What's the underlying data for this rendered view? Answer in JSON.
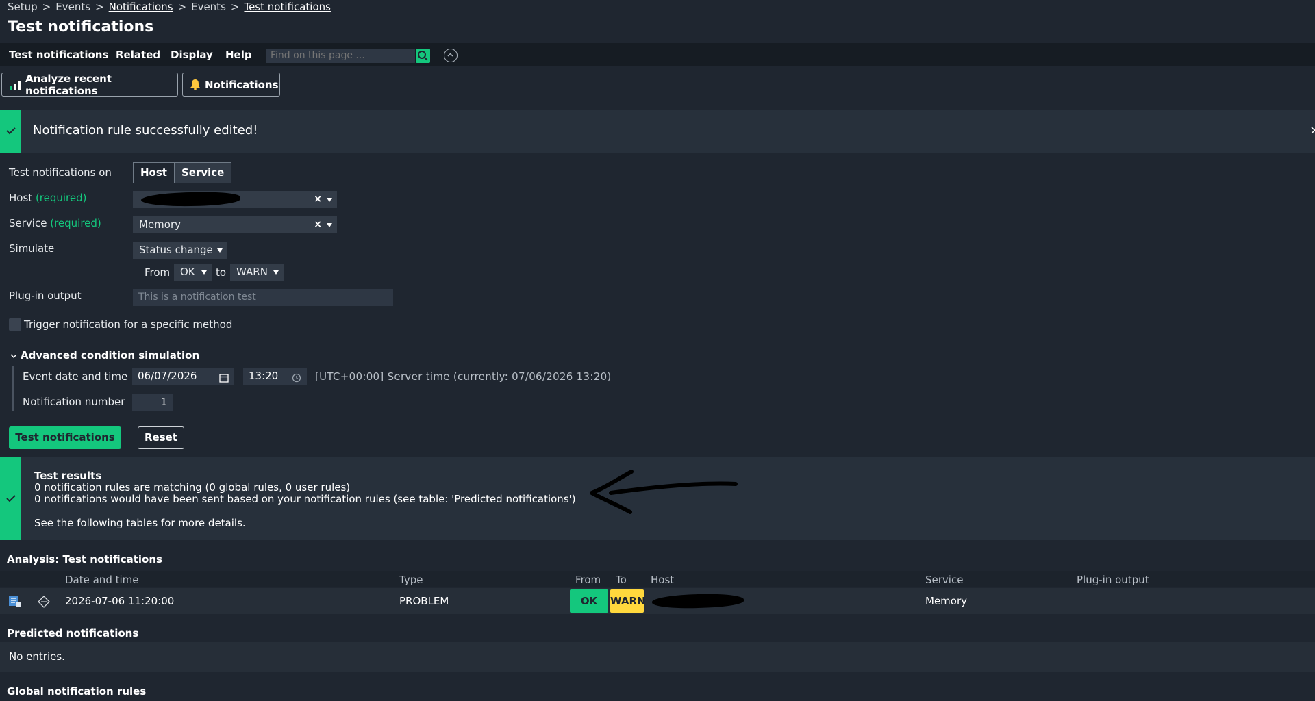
{
  "breadcrumb": {
    "items": [
      "Setup",
      "Events",
      "Notifications",
      "Events",
      "Test notifications"
    ],
    "separator": ">"
  },
  "page_title": "Test notifications",
  "menubar": {
    "items": [
      "Test notifications",
      "Related",
      "Display",
      "Help"
    ],
    "search_placeholder": "Find on this page ..."
  },
  "actions": {
    "analyze_label": "Analyze recent notifications",
    "notifications_label": "Notifications"
  },
  "success_banner": {
    "message": "Notification rule successfully edited!",
    "close": "×"
  },
  "form": {
    "test_on_label": "Test notifications on",
    "test_on_options": [
      "Host",
      "Service"
    ],
    "test_on_selected": "Host",
    "host_label": "Host",
    "required": "(required)",
    "service_label": "Service",
    "service_value": "Memory",
    "clear": "×",
    "simulate_label": "Simulate",
    "simulate_value": "Status change",
    "from_label": "From",
    "from_value": "OK",
    "to_label": "to",
    "to_value": "WARN",
    "plugin_output_label": "Plug-in output",
    "plugin_output_placeholder": "This is a notification test",
    "trigger_label": "Trigger notification for a specific method"
  },
  "advanced": {
    "header": "Advanced condition simulation",
    "date_label": "Event date and time",
    "date_value": "06/07/2026",
    "time_value": "13:20",
    "server_time": "[UTC+00:00] Server time (currently: 07/06/2026 13:20)",
    "number_label": "Notification number",
    "number_value": "1"
  },
  "buttons": {
    "test": "Test notifications",
    "reset": "Reset"
  },
  "results": {
    "title": "Test results",
    "line1": "0 notification rules are matching (0 global rules, 0 user rules)",
    "line2": "0 notifications would have been sent based on your notification rules (see table: 'Predicted notifications')",
    "line3": "See the following tables for more details."
  },
  "analysis": {
    "title": "Analysis: Test notifications",
    "columns": [
      "Date and time",
      "Type",
      "From",
      "To",
      "Host",
      "Service",
      "Plug-in output"
    ],
    "rows": [
      {
        "date": "2026-07-06 11:20:00",
        "type": "PROBLEM",
        "from": "OK",
        "to": "WARN",
        "service": "Memory",
        "output": ""
      }
    ]
  },
  "predicted": {
    "title": "Predicted notifications",
    "empty": "No entries."
  },
  "global_rules": {
    "title": "Global notification rules"
  },
  "colors": {
    "accent": "#14c77d",
    "warn": "#ffd83d",
    "background": "#1f2630"
  }
}
